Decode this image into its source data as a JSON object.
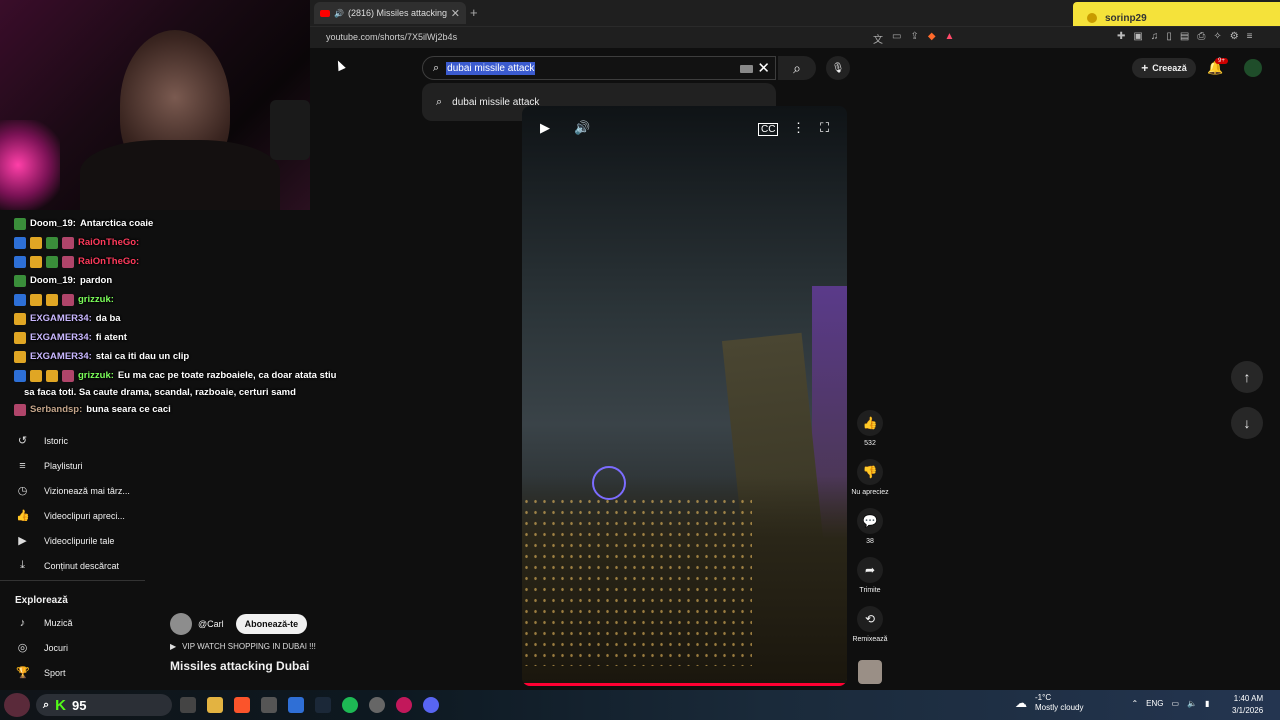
{
  "browser": {
    "tab_title": "(2816) Missiles attacking Dubai",
    "url": "youtube.com/shorts/7X5ilWj2b4s",
    "profile_name": "sorinp29"
  },
  "search": {
    "query": "dubai missile attack",
    "suggestion": "dubai missile attack"
  },
  "header": {
    "create_label": "Creează",
    "notif_badge": "9+"
  },
  "chat": [
    {
      "user": "Doom_19:",
      "user_color": "#ffffff",
      "text": "Antarctica coaie"
    },
    {
      "user": "RaiOnTheGo:",
      "user_color": "#ff3b5c",
      "text": ""
    },
    {
      "user": "RaiOnTheGo:",
      "user_color": "#ff3b5c",
      "text": ""
    },
    {
      "user": "Doom_19:",
      "user_color": "#ffffff",
      "text": "pardon"
    },
    {
      "user": "grizzuk:",
      "user_color": "#7cff5a",
      "text": ""
    },
    {
      "user": "EXGAMER34:",
      "user_color": "#c9b7ff",
      "text": "da ba"
    },
    {
      "user": "EXGAMER34:",
      "user_color": "#c9b7ff",
      "text": "fi atent"
    },
    {
      "user": "EXGAMER34:",
      "user_color": "#c9b7ff",
      "text": "stai ca iti dau un clip"
    },
    {
      "user": "grizzuk:",
      "user_color": "#7cff5a",
      "text": "Eu ma cac pe toate razboaiele, ca doar atata stiu"
    },
    {
      "user": "",
      "user_color": "#ffffff",
      "text": "sa faca toti. Sa caute drama, scandal, razboaie, certuri samd"
    },
    {
      "user": "Serbandsp:",
      "user_color": "#c4a58a",
      "text": "buna seara ce caci"
    }
  ],
  "sidebar": {
    "items": [
      {
        "label": "Istoric",
        "icon": "history-icon"
      },
      {
        "label": "Playlisturi",
        "icon": "playlist-icon"
      },
      {
        "label": "Vizionează mai târz...",
        "icon": "clock-icon"
      },
      {
        "label": "Videoclipuri apreci...",
        "icon": "like-icon"
      },
      {
        "label": "Videoclipurile tale",
        "icon": "video-icon"
      },
      {
        "label": "Conținut descărcat",
        "icon": "download-icon"
      }
    ],
    "explore_title": "Explorează",
    "explore_items": [
      {
        "label": "Muzică",
        "icon": "music-icon"
      },
      {
        "label": "Jocuri",
        "icon": "gamepad-icon"
      },
      {
        "label": "Sport",
        "icon": "trophy-icon"
      }
    ]
  },
  "short": {
    "channel": "@Carl",
    "subscribe_label": "Abonează-te",
    "sound": "VIP WATCH SHOPPING IN DUBAI !!!",
    "title": "Missiles attacking Dubai",
    "progress": 1.0
  },
  "actions": {
    "likes": "532",
    "dislike_label": "Nu apreciez",
    "comments": "38",
    "share_label": "Trimite",
    "remix_label": "Remixează"
  },
  "taskbar": {
    "search_number": "95",
    "weather_temp": "-1°C",
    "weather_desc": "Mostly cloudy",
    "lang": "ENG",
    "time": "1:40 AM",
    "date": "3/1/2026"
  },
  "colors": {
    "accent_red": "#ff0033",
    "highlight": "#3b5bcf",
    "profile_pill": "#f5e23a"
  }
}
